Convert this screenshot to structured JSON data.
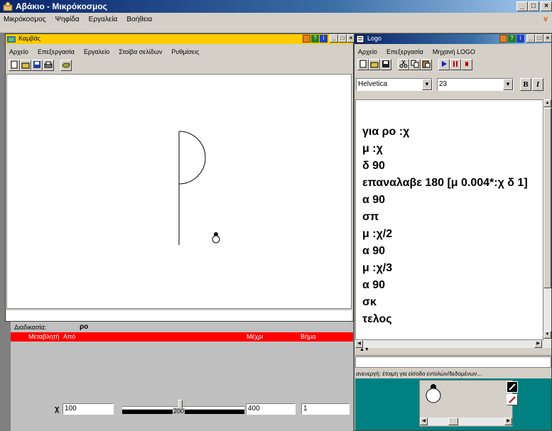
{
  "app": {
    "title": "Αβάκιο - Μικρόκοσμος",
    "menu": [
      "Μικρόκοσμος",
      "Ψηφίδα",
      "Εργαλεία",
      "Βοήθεια"
    ],
    "buttons": {
      "minimize": "_",
      "maximize": "□",
      "close": "×"
    }
  },
  "canvas_window": {
    "title": "Καμβάς",
    "menu": [
      "Αρχείο",
      "Επεξεργασία",
      "Εργαλείο",
      "Στοίβα σελίδων",
      "Ρυθμίσεις"
    ],
    "toolbar": [
      "new-page",
      "open-file",
      "save-file",
      "print",
      "turtle-tool"
    ]
  },
  "procedure_panel": {
    "label": "Διαδικασία:",
    "name": "ρο",
    "headers": {
      "variable": "Μεταβλητή",
      "from": "Από",
      "to": "Μέχρι",
      "step": "Βήμα"
    },
    "variable": {
      "name": "χ",
      "from_value": "100",
      "slider_value_label": "200",
      "slider_value": 200,
      "slider_min": 100,
      "slider_max": 400,
      "to_value": "400",
      "step_value": "1"
    }
  },
  "logo_window": {
    "title": "Logo",
    "menu": [
      "Αρχείο",
      "Επεξεργασία",
      "Μηχανή LOGO"
    ],
    "toolbar": [
      "new",
      "open",
      "save",
      "cut",
      "copy",
      "paste",
      "run",
      "pause",
      "stop"
    ],
    "font": "Helvetica",
    "font_size": "23",
    "bold": "B",
    "italic": "I",
    "code_lines": [
      "για ρο :χ",
      "μ :χ",
      "δ 90",
      "επαναλαβε 180 [μ 0.004*:χ δ 1]",
      "α 90",
      "σπ",
      "μ :χ/2",
      "α 90",
      "μ :χ/3",
      "α 90",
      "σκ",
      "τελος"
    ],
    "status": "ανενεργή: έτοιμη για είσοδο εντολών/δεδομένων..."
  },
  "colors": {
    "title_active": "#0a246a",
    "title_gradient_end": "#a6caf0",
    "header_red": "#ff0000",
    "face": "#d4d0c8",
    "turtle_panel": "#008080",
    "canvas_bg": "#ffffff"
  }
}
